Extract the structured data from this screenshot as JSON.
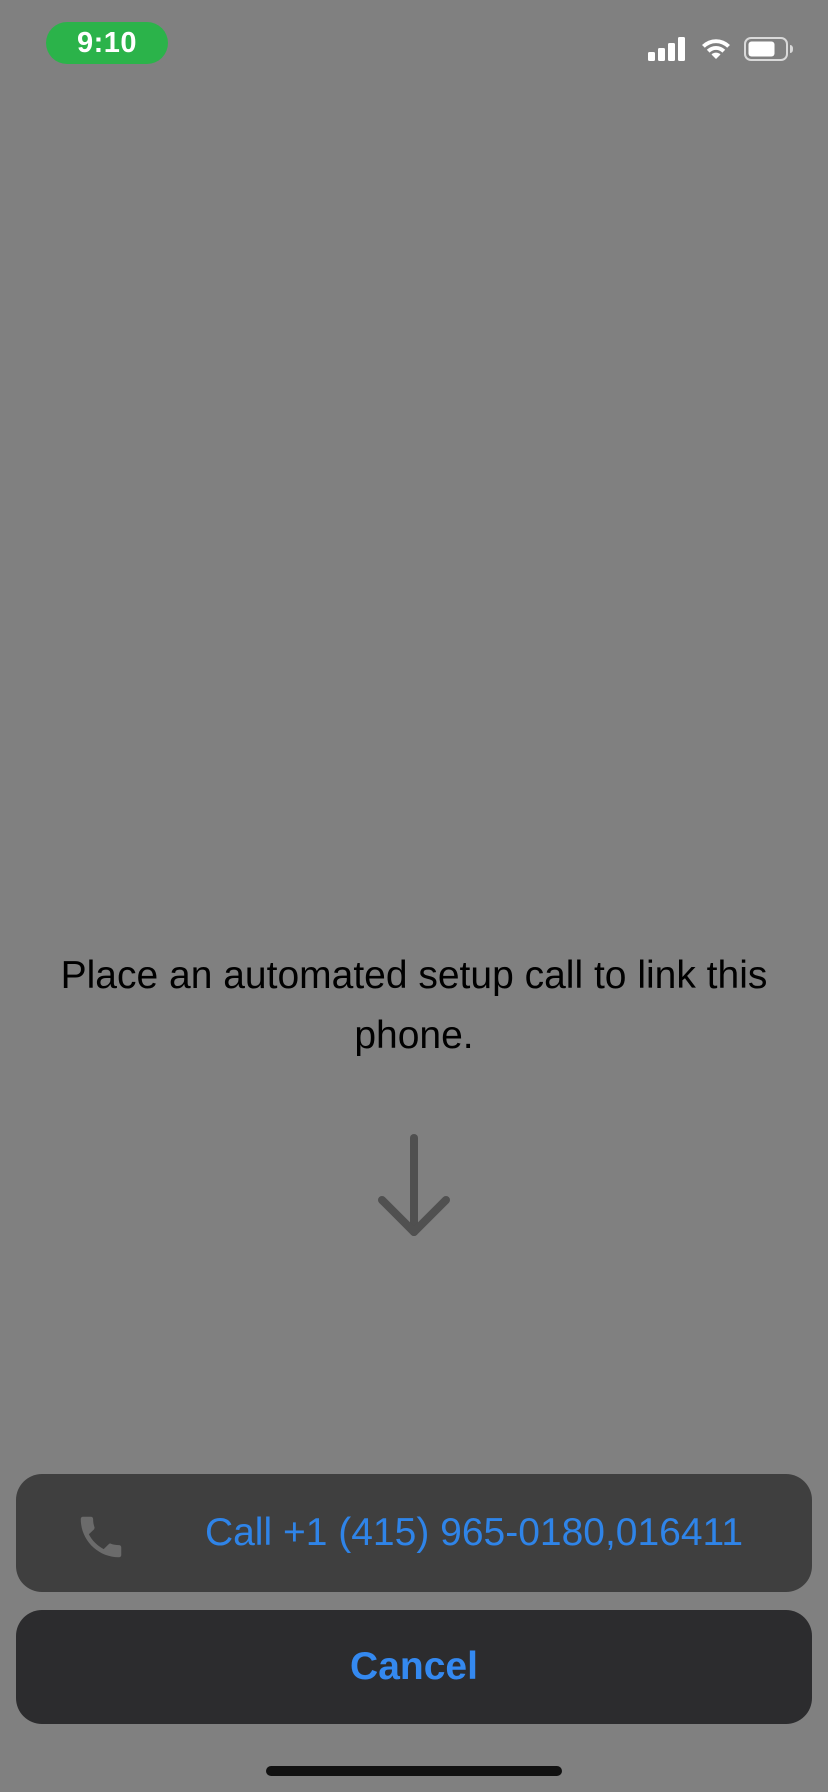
{
  "status_bar": {
    "time": "9:10",
    "icons": [
      "cellular-signal-icon",
      "wifi-icon",
      "battery-icon"
    ]
  },
  "message": "Place an automated setup call to link this phone.",
  "arrow_icon": "arrow-down-icon",
  "action_sheet": {
    "call_label": "Call +1 (415) 965-0180,016411",
    "call_icon": "phone-icon",
    "cancel_label": "Cancel"
  },
  "colors": {
    "background": "#808080",
    "time_pill": "#2bb34a",
    "action_text": "#2f84e8",
    "sheet": "#3f3f3f",
    "cancel_sheet": "#2c2c2e"
  }
}
